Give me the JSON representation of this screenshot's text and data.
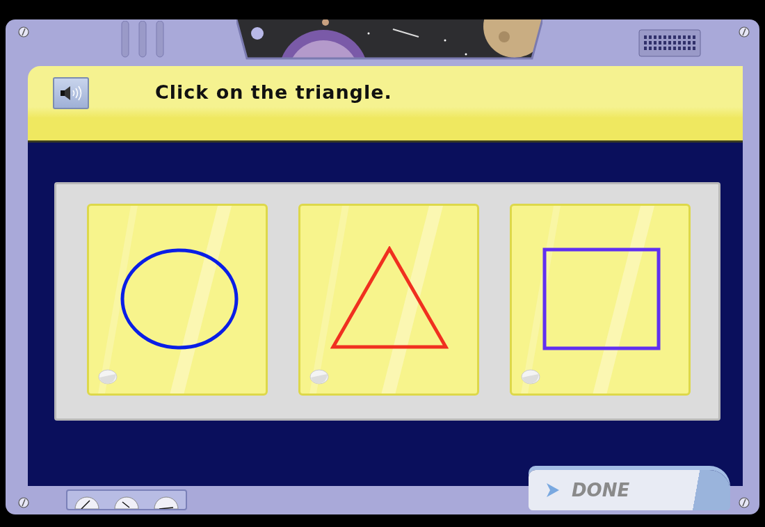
{
  "prompt": "Click on the triangle.",
  "choices": [
    {
      "kind": "circle",
      "color": "#0a1ee6",
      "selected": false
    },
    {
      "kind": "triangle",
      "color": "#f03020",
      "selected": false
    },
    {
      "kind": "square",
      "color": "#6030f0",
      "selected": false
    }
  ],
  "done_button": "DONE"
}
